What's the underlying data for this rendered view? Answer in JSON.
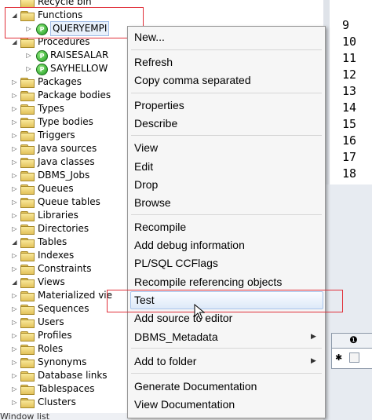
{
  "tree": {
    "rows": [
      {
        "label": "Recycle bin",
        "expander": "",
        "icon": "folder"
      },
      {
        "label": "Functions",
        "expander": "◢",
        "icon": "folder"
      },
      {
        "label": "QUERYEMPI",
        "expander": "▷",
        "icon": "function"
      },
      {
        "label": "Procedures",
        "expander": "◢",
        "icon": "folder"
      },
      {
        "label": "RAISESALAR",
        "expander": "▷",
        "icon": "function"
      },
      {
        "label": "SAYHELLOW",
        "expander": "▷",
        "icon": "function"
      },
      {
        "label": "Packages",
        "expander": "▷",
        "icon": "folder"
      },
      {
        "label": "Package bodies",
        "expander": "▷",
        "icon": "folder"
      },
      {
        "label": "Types",
        "expander": "▷",
        "icon": "folder"
      },
      {
        "label": "Type bodies",
        "expander": "▷",
        "icon": "folder"
      },
      {
        "label": "Triggers",
        "expander": "▷",
        "icon": "folder"
      },
      {
        "label": "Java sources",
        "expander": "▷",
        "icon": "folder"
      },
      {
        "label": "Java classes",
        "expander": "▷",
        "icon": "folder"
      },
      {
        "label": "DBMS_Jobs",
        "expander": "▷",
        "icon": "folder"
      },
      {
        "label": "Queues",
        "expander": "▷",
        "icon": "folder"
      },
      {
        "label": "Queue tables",
        "expander": "▷",
        "icon": "folder"
      },
      {
        "label": "Libraries",
        "expander": "▷",
        "icon": "folder"
      },
      {
        "label": "Directories",
        "expander": "▷",
        "icon": "folder"
      },
      {
        "label": "Tables",
        "expander": "◢",
        "icon": "folder"
      },
      {
        "label": "Indexes",
        "expander": "▷",
        "icon": "folder"
      },
      {
        "label": "Constraints",
        "expander": "▷",
        "icon": "folder"
      },
      {
        "label": "Views",
        "expander": "◢",
        "icon": "folder"
      },
      {
        "label": "Materialized vie",
        "expander": "▷",
        "icon": "folder"
      },
      {
        "label": "Sequences",
        "expander": "▷",
        "icon": "folder"
      },
      {
        "label": "Users",
        "expander": "▷",
        "icon": "folder"
      },
      {
        "label": "Profiles",
        "expander": "▷",
        "icon": "folder"
      },
      {
        "label": "Roles",
        "expander": "▷",
        "icon": "folder"
      },
      {
        "label": "Synonyms",
        "expander": "▷",
        "icon": "folder"
      },
      {
        "label": "Database links",
        "expander": "▷",
        "icon": "folder"
      },
      {
        "label": "Tablespaces",
        "expander": "▷",
        "icon": "folder"
      },
      {
        "label": "Clusters",
        "expander": "▷",
        "icon": "folder"
      }
    ],
    "function_badge": "P",
    "status_fragment": "Window list"
  },
  "editor": {
    "line_numbers": [
      "9",
      "10",
      "11",
      "12",
      "13",
      "14",
      "15",
      "16",
      "17",
      "18"
    ],
    "grid_header_icon": "❶",
    "grid_row_marker": "✱"
  },
  "context_menu": {
    "items": [
      {
        "label": "New...",
        "group": 0
      },
      {
        "label": "Refresh",
        "group": 1
      },
      {
        "label": "Copy comma separated",
        "group": 1
      },
      {
        "label": "Properties",
        "group": 2
      },
      {
        "label": "Describe",
        "group": 2
      },
      {
        "label": "View",
        "group": 3
      },
      {
        "label": "Edit",
        "group": 3
      },
      {
        "label": "Drop",
        "group": 3
      },
      {
        "label": "Browse",
        "group": 3
      },
      {
        "label": "Recompile",
        "group": 4
      },
      {
        "label": "Add debug information",
        "group": 4
      },
      {
        "label": "PL/SQL CCFlags",
        "group": 4
      },
      {
        "label": "Recompile referencing objects",
        "group": 4
      },
      {
        "label": "Test",
        "group": 4,
        "hovered": true
      },
      {
        "label": "Add source to editor",
        "group": 4
      },
      {
        "label": "DBMS_Metadata",
        "group": 4,
        "submenu": true
      },
      {
        "label": "Add to folder",
        "group": 5,
        "submenu": true
      },
      {
        "label": "Generate Documentation",
        "group": 6
      },
      {
        "label": "View Documentation",
        "group": 6
      }
    ],
    "submenu_arrow": "▶"
  },
  "colors": {
    "highlight_box": "#e0303a",
    "hover_border": "#a8c4ec"
  }
}
